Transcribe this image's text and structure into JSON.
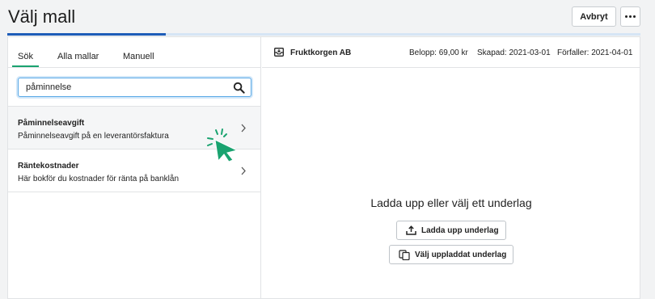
{
  "header": {
    "title": "Välj mall",
    "abort_label": "Avbryt",
    "more_icon": "more-horizontal-icon",
    "progress_fraction": 0.25
  },
  "tabs": [
    {
      "label": "Sök",
      "active": true
    },
    {
      "label": "Alla mallar",
      "active": false
    },
    {
      "label": "Manuell",
      "active": false
    }
  ],
  "search": {
    "value": "påminnelse",
    "placeholder": "",
    "icon": "search-icon"
  },
  "results": [
    {
      "title": "Påminnelseavgift",
      "description": "Påminnelseavgift på en leverantörsfaktura",
      "hovered": true
    },
    {
      "title": "Räntekostnader",
      "description": "Här bokför du kostnader för ränta på banklån",
      "hovered": false
    }
  ],
  "document": {
    "company": "Fruktkorgen AB",
    "amount": "Belopp: 69,00 kr",
    "created": "Skapad: 2021-03-01",
    "due": "Förfaller: 2021-04-01"
  },
  "empty_state": {
    "title": "Ladda upp eller välj ett underlag",
    "upload_label": "Ladda upp underlag",
    "choose_label": "Välj uppladdat underlag"
  },
  "colors": {
    "accent": "#1e5db8",
    "tab_active": "#1aa370",
    "cursor": "#1aa370"
  }
}
